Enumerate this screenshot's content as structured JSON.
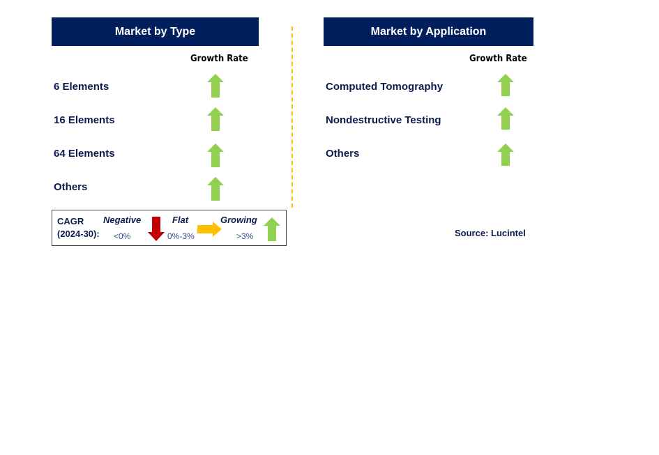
{
  "left_panel": {
    "title": "Market by Type",
    "growth_rate_label": "Growth Rate",
    "items": [
      {
        "label": "6 Elements",
        "trend": "growing"
      },
      {
        "label": "16 Elements",
        "trend": "growing"
      },
      {
        "label": "64 Elements",
        "trend": "growing"
      },
      {
        "label": "Others",
        "trend": "growing"
      }
    ]
  },
  "right_panel": {
    "title": "Market by Application",
    "growth_rate_label": "Growth Rate",
    "items": [
      {
        "label": "Computed Tomography",
        "trend": "growing"
      },
      {
        "label": "Nondestructive Testing",
        "trend": "growing"
      },
      {
        "label": "Others",
        "trend": "growing"
      }
    ]
  },
  "legend": {
    "cagr_label": "CAGR",
    "period_label": "(2024-30):",
    "negative": {
      "label": "Negative",
      "range": "<0%",
      "icon": "arrow-down-icon"
    },
    "flat": {
      "label": "Flat",
      "range": "0%-3%",
      "icon": "arrow-right-icon"
    },
    "growing": {
      "label": "Growing",
      "range": ">3%",
      "icon": "arrow-up-icon"
    }
  },
  "source": "Source: Lucintel",
  "colors": {
    "header_bg": "#001f5c",
    "growing": "#92d050",
    "flat": "#ffc000",
    "negative": "#c00000",
    "divider": "#ffc000"
  }
}
